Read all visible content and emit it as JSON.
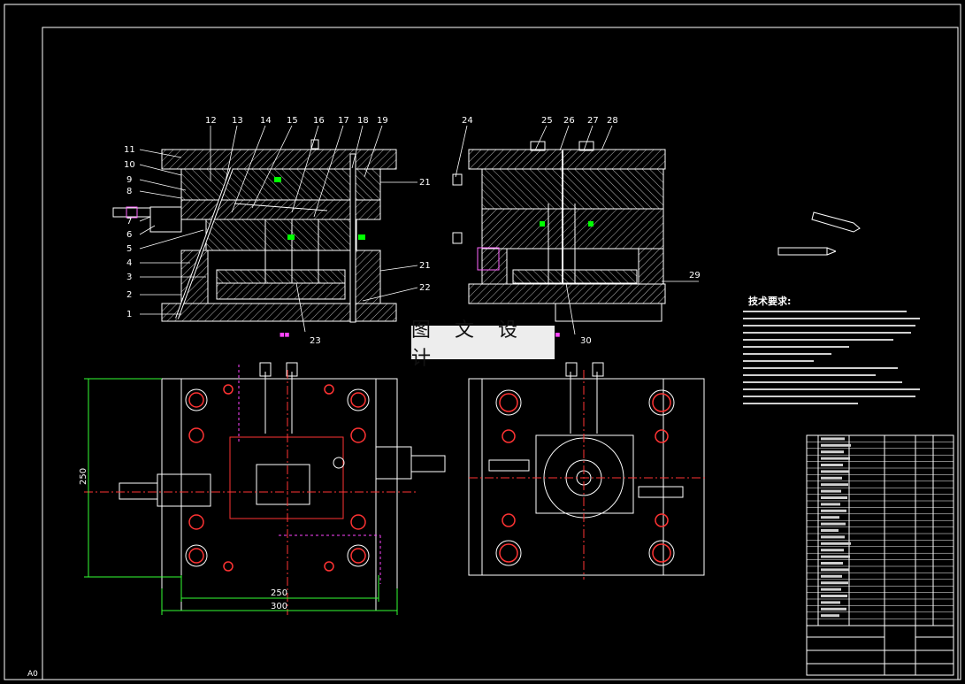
{
  "drawing": {
    "banner_text": "图 文 设 计",
    "technical_requirements_title": "技术要求:",
    "corner_mark": "A0",
    "callouts": [
      {
        "id": "c1",
        "text": "1"
      },
      {
        "id": "c2",
        "text": "2"
      },
      {
        "id": "c3",
        "text": "3"
      },
      {
        "id": "c4",
        "text": "4"
      },
      {
        "id": "c5",
        "text": "5"
      },
      {
        "id": "c6",
        "text": "6"
      },
      {
        "id": "c7",
        "text": "7"
      },
      {
        "id": "c8",
        "text": "8"
      },
      {
        "id": "c9",
        "text": "9"
      },
      {
        "id": "c10",
        "text": "10"
      },
      {
        "id": "c11",
        "text": "11"
      },
      {
        "id": "c12",
        "text": "12"
      },
      {
        "id": "c13",
        "text": "13"
      },
      {
        "id": "c14",
        "text": "14"
      },
      {
        "id": "c15",
        "text": "15"
      },
      {
        "id": "c16",
        "text": "16"
      },
      {
        "id": "c17",
        "text": "17"
      },
      {
        "id": "c18",
        "text": "18"
      },
      {
        "id": "c19",
        "text": "19"
      },
      {
        "id": "c20",
        "text": "21"
      },
      {
        "id": "c21",
        "text": "21"
      },
      {
        "id": "c22",
        "text": "22"
      },
      {
        "id": "c23",
        "text": "23"
      },
      {
        "id": "c24",
        "text": "24"
      },
      {
        "id": "c25",
        "text": "25"
      },
      {
        "id": "c26",
        "text": "26"
      },
      {
        "id": "c27",
        "text": "27"
      },
      {
        "id": "c28",
        "text": "28"
      },
      {
        "id": "c29",
        "text": "29"
      },
      {
        "id": "c30",
        "text": "30"
      }
    ],
    "dimensions": {
      "height_250": "250",
      "width_250": "250",
      "width_300": "300"
    }
  },
  "colors": {
    "background": "#000000",
    "outline": "#ffffff",
    "hatch": "#c8c8c8",
    "part_accent": "#ff66ff",
    "center_line": "#ff3333",
    "dimension": "#33ff33",
    "highlight": "#00ff00",
    "marker": "#ff44ff"
  }
}
